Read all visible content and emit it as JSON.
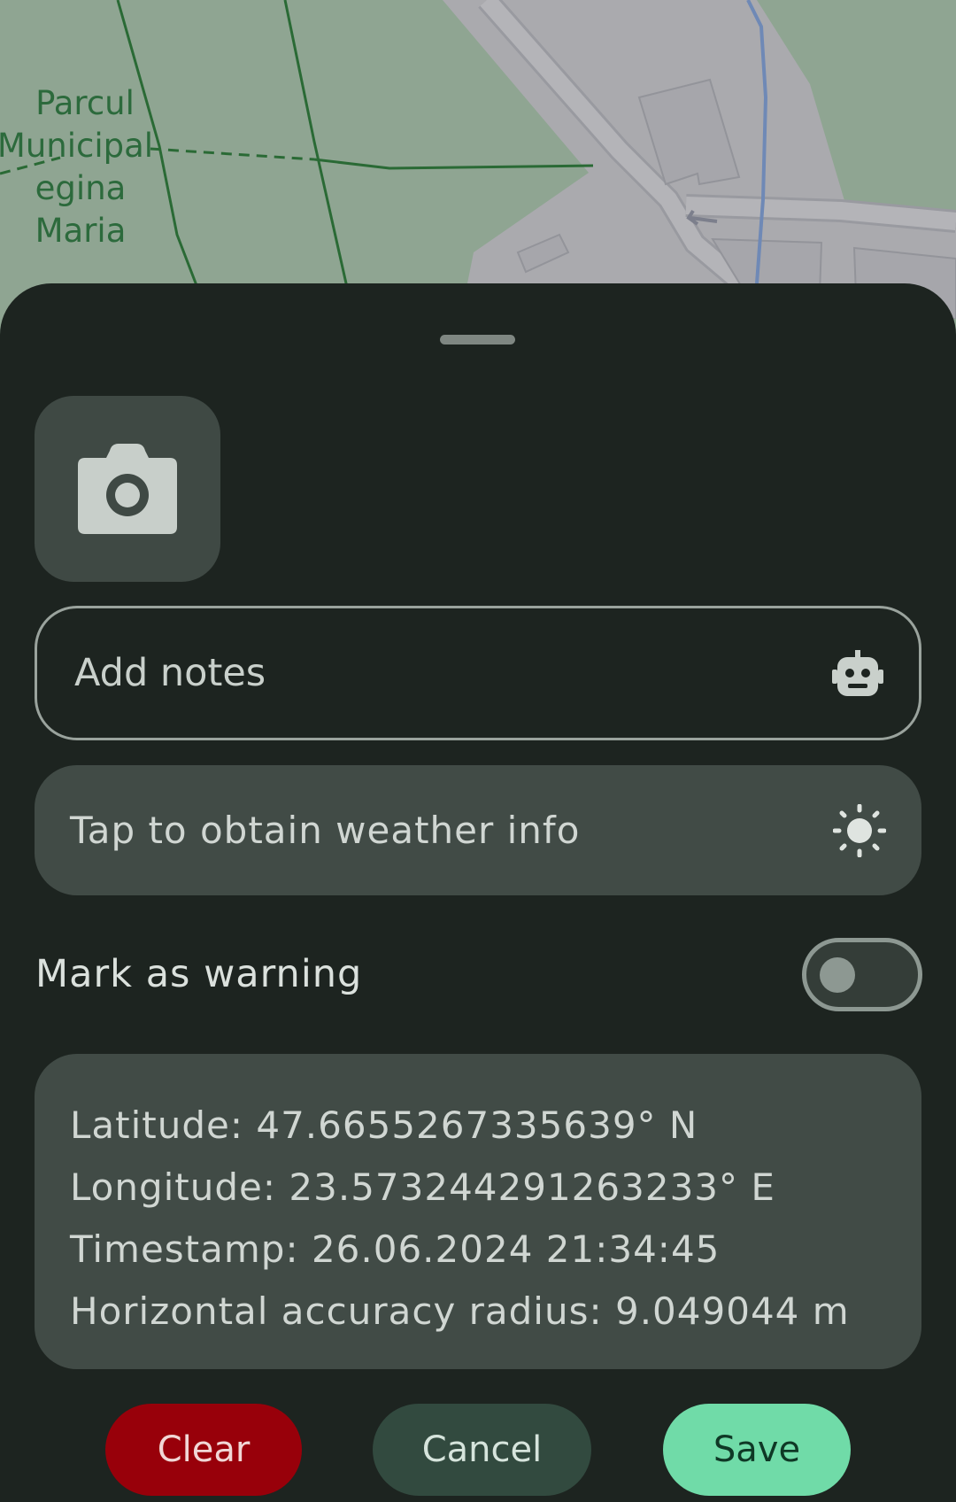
{
  "map": {
    "park_label_lines": [
      "Parcul",
      "Municipal",
      "egina Maria"
    ]
  },
  "sheet": {
    "notes": {
      "placeholder": "Add notes",
      "icon": "robot-icon"
    },
    "weather": {
      "label": "Tap to obtain weather info",
      "icon": "sun-icon"
    },
    "warning": {
      "label": "Mark as warning",
      "enabled": false
    },
    "info": {
      "latitude": "Latitude: 47.6655267335639° N",
      "longitude": "Longitude: 23.573244291263233° E",
      "timestamp": "Timestamp: 26.06.2024 21:34:45",
      "accuracy": "Horizontal accuracy radius: 9.049044 m"
    },
    "actions": {
      "clear": "Clear",
      "cancel": "Cancel",
      "save": "Save"
    },
    "colors": {
      "sheet_bg": "#1d2420",
      "card_bg": "#414b46",
      "clear_bg": "#98000a",
      "cancel_bg": "#324a3f",
      "save_bg": "#70dba8"
    }
  }
}
